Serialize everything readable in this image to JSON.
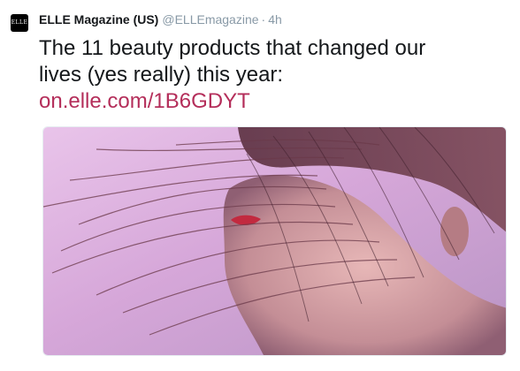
{
  "tweet": {
    "avatar": {
      "text": "ELLE",
      "bg": "#000000"
    },
    "display_name": "ELLE Magazine (US)",
    "handle": "@ELLEmagazine",
    "separator": "·",
    "time": "4h",
    "text_line_1": "The 11 beauty products that changed our",
    "text_line_2": "lives (yes really) this year:",
    "link": "on.elle.com/1B6GDYT",
    "link_color": "#b42e5a",
    "media": {
      "icon": "photo-image"
    }
  }
}
